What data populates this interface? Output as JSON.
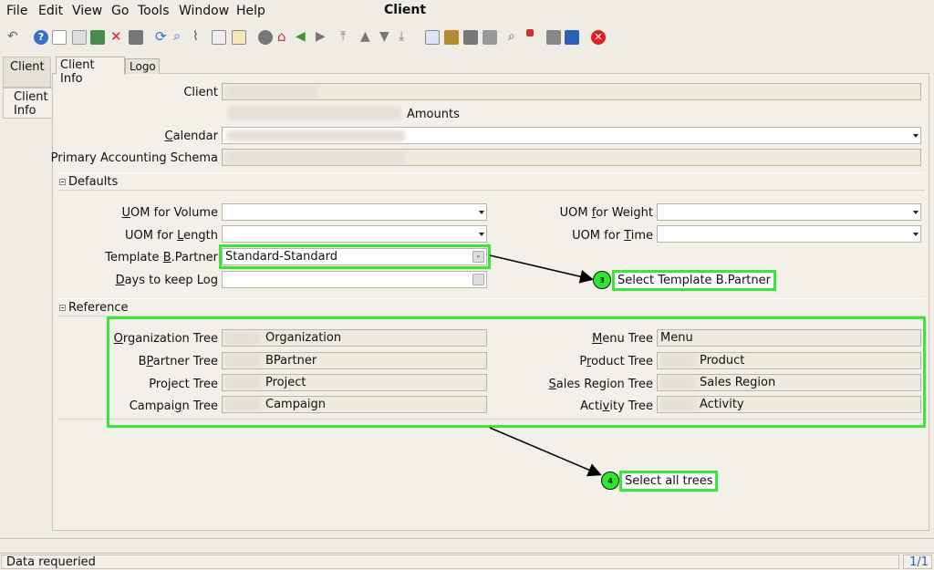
{
  "menu": {
    "file": "File",
    "edit": "Edit",
    "view": "View",
    "go": "Go",
    "tools": "Tools",
    "window": "Window",
    "help": "Help"
  },
  "window_title": "Client",
  "sidebar": {
    "tab1": "Client",
    "tab2_line1": "Client",
    "tab2_line2": "Info"
  },
  "tabs": {
    "client_info": "Client Info",
    "logo": "Logo"
  },
  "fields": {
    "client_label": "Client",
    "amounts_text": "Amounts",
    "calendar_label": "Calendar",
    "primary_schema_label": "Primary Accounting Schema"
  },
  "defaults": {
    "header": "Defaults",
    "uom_volume_label": "UOM for Volume",
    "uom_length_label": "UOM for Length",
    "template_bp_label": "Template B.Partner",
    "template_bp_value": "Standard-Standard",
    "days_log_label": "Days to keep Log",
    "uom_weight_label": "UOM for Weight",
    "uom_time_label": "UOM for Time"
  },
  "reference": {
    "header": "Reference",
    "org_tree_label": "Organization Tree",
    "org_tree_value": "Organization",
    "bp_tree_label": "BPartner Tree",
    "bp_tree_value": "BPartner",
    "project_tree_label": "Project Tree",
    "project_tree_value": "Project",
    "campaign_tree_label": "Campaign Tree",
    "campaign_tree_value": "Campaign",
    "menu_tree_label": "Menu Tree",
    "menu_tree_value": "Menu",
    "product_tree_label": "Product Tree",
    "product_tree_value": "Product",
    "sales_region_tree_label": "Sales Region Tree",
    "sales_region_tree_value": "Sales Region",
    "activity_tree_label": "Activity Tree",
    "activity_tree_value": "Activity"
  },
  "callouts": {
    "c3_num": "3",
    "c3_text": "Select Template B.Partner",
    "c4_num": "4",
    "c4_text": "Select all trees"
  },
  "status": {
    "message": "Data requeried",
    "record": "1/1"
  },
  "colors": {
    "highlight": "#3be63b",
    "callout_fill": "#2ee82e",
    "readonly_field": "#ecebde"
  }
}
